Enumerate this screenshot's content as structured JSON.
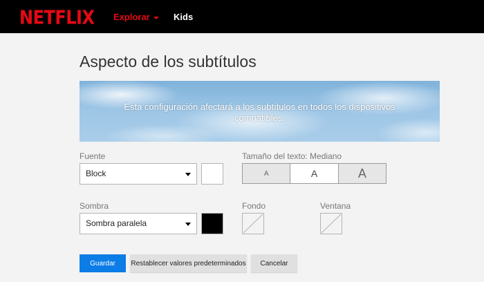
{
  "header": {
    "logo": "NETFLIX",
    "nav": {
      "explore_label": "Explorar",
      "kids_label": "Kids"
    }
  },
  "page": {
    "title": "Aspecto de los subtítulos",
    "preview_text": "Esta configuración afectará a los subtítulos en todos los dispositivos compatibles."
  },
  "settings": {
    "font": {
      "label": "Fuente",
      "value": "Block",
      "color": "#ffffff"
    },
    "text_size": {
      "label": "Tamaño del texto: Mediano",
      "options": [
        "A",
        "A",
        "A"
      ],
      "selected_index": 1
    },
    "shadow": {
      "label": "Sombra",
      "value": "Sombra paralela",
      "color": "#000000"
    },
    "background": {
      "label": "Fondo"
    },
    "window": {
      "label": "Ventana"
    }
  },
  "actions": {
    "save_label": "Guardar",
    "reset_label": "Restablecer valores predeterminados",
    "cancel_label": "Cancelar"
  }
}
